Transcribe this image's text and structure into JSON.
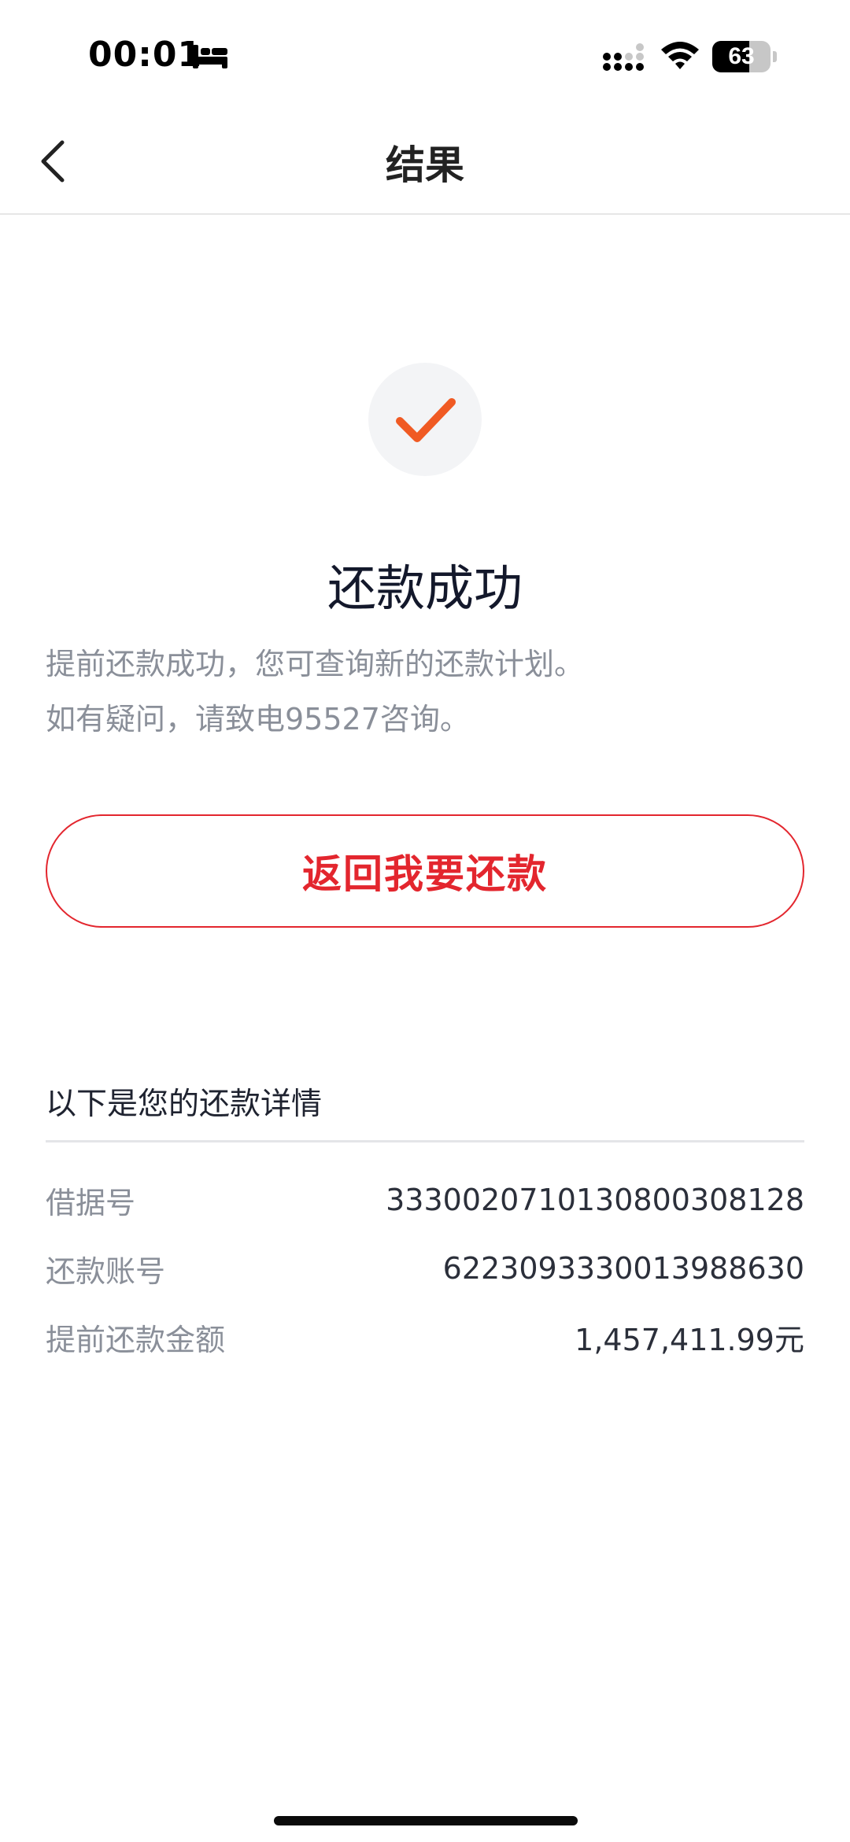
{
  "status_bar": {
    "time": "00:01",
    "battery_level": "63",
    "icons": [
      "sleep-icon",
      "cellular-signal-icon",
      "wifi-icon",
      "battery-icon"
    ]
  },
  "nav": {
    "title": "结果",
    "back_icon": "chevron-left-icon"
  },
  "result": {
    "icon": "checkmark-icon",
    "title": "还款成功",
    "description_line1": "提前还款成功，您可查询新的还款计划。",
    "description_line2": "如有疑问，请致电95527咨询。"
  },
  "actions": {
    "return_label": "返回我要还款"
  },
  "details": {
    "header": "以下是您的还款详情",
    "rows": [
      {
        "label": "借据号",
        "value": "3330020710130800308128"
      },
      {
        "label": "还款账号",
        "value": "6223093330013988630"
      },
      {
        "label": "提前还款金额",
        "value": "1,457,411.99元"
      }
    ]
  },
  "colors": {
    "accent_red": "#e3262e",
    "check_orange": "#f05a23"
  }
}
